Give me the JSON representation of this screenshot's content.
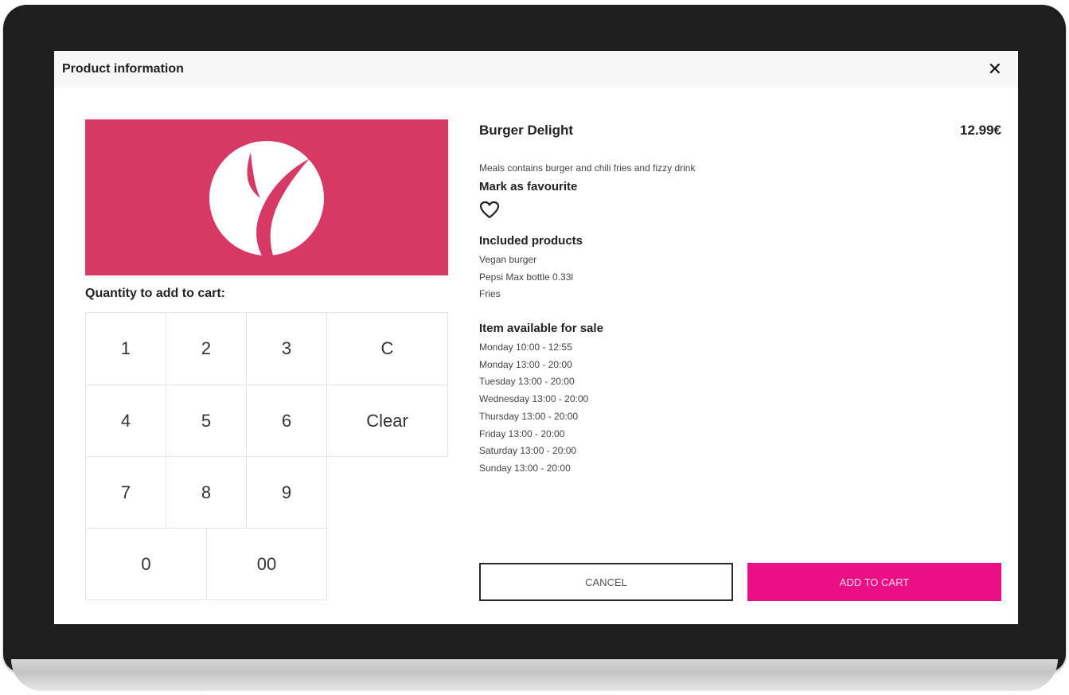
{
  "dialog": {
    "title": "Product information",
    "close_icon": "close-icon"
  },
  "product": {
    "name": "Burger Delight",
    "price": "12.99€",
    "description": "Meals contains burger and chili fries and fizzy drink",
    "image_color": "#d63a64",
    "logo_icon": "leaf-logo-icon"
  },
  "favourite": {
    "label": "Mark as favourite",
    "icon": "heart-icon"
  },
  "included": {
    "title": "Included products",
    "items": [
      "Vegan burger",
      "Pepsi Max bottle 0.33l",
      "Fries"
    ]
  },
  "availability": {
    "title": "Item available for sale",
    "times": [
      "Monday 10:00 - 12:55",
      "Monday 13:00 - 20:00",
      "Tuesday 13:00 - 20:00",
      "Wednesday 13:00 - 20:00",
      "Thursday 13:00 - 20:00",
      "Friday 13:00 - 20:00",
      "Saturday 13:00 - 20:00",
      "Sunday 13:00 - 20:00"
    ]
  },
  "quantity": {
    "label": "Quantity to add to cart:",
    "keys": {
      "k1": "1",
      "k2": "2",
      "k3": "3",
      "kc": "C",
      "k4": "4",
      "k5": "5",
      "k6": "6",
      "kclear": "Clear",
      "k7": "7",
      "k8": "8",
      "k9": "9",
      "k0": "0",
      "k00": "00"
    }
  },
  "actions": {
    "cancel_label": "CANCEL",
    "add_label": "ADD TO CART",
    "add_color": "#ea0f84"
  }
}
